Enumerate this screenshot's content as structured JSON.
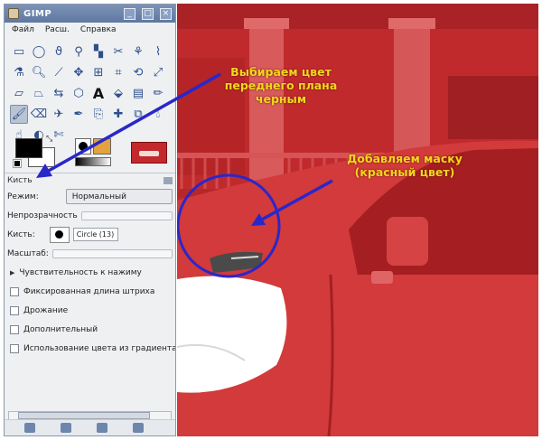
{
  "window": {
    "title": "GIMP"
  },
  "menu": [
    "Файл",
    "Расш.",
    "Справка"
  ],
  "tools": [
    {
      "icon": "rect-select-icon",
      "glyph": "▭"
    },
    {
      "icon": "ellipse-select-icon",
      "glyph": "◯"
    },
    {
      "icon": "free-select-icon",
      "glyph": "ϑ"
    },
    {
      "icon": "fuzzy-select-icon",
      "glyph": "⚲"
    },
    {
      "icon": "select-by-color-icon",
      "glyph": "▚"
    },
    {
      "icon": "scissors-icon",
      "glyph": "✂"
    },
    {
      "icon": "foreground-select-icon",
      "glyph": "⚘"
    },
    {
      "icon": "paths-icon",
      "glyph": "⌇"
    },
    {
      "icon": "color-picker-icon",
      "glyph": "⚗"
    },
    {
      "icon": "zoom-icon",
      "glyph": "🔍︎"
    },
    {
      "icon": "measure-icon",
      "glyph": "⟋"
    },
    {
      "icon": "move-icon",
      "glyph": "✥"
    },
    {
      "icon": "alignment-icon",
      "glyph": "⊞"
    },
    {
      "icon": "crop-icon",
      "glyph": "⌗"
    },
    {
      "icon": "rotate-icon",
      "glyph": "⟲"
    },
    {
      "icon": "scale-icon",
      "glyph": "⤢"
    },
    {
      "icon": "shear-icon",
      "glyph": "▱"
    },
    {
      "icon": "perspective-icon",
      "glyph": "⏢"
    },
    {
      "icon": "flip-icon",
      "glyph": "⇆"
    },
    {
      "icon": "cage-icon",
      "glyph": "⬡"
    },
    {
      "icon": "text-icon",
      "glyph": "A"
    },
    {
      "icon": "bucket-fill-icon",
      "glyph": "⬙"
    },
    {
      "icon": "blend-icon",
      "glyph": "▤"
    },
    {
      "icon": "pencil-icon",
      "glyph": "✏"
    },
    {
      "icon": "paintbrush-icon",
      "glyph": "🖌︎"
    },
    {
      "icon": "eraser-icon",
      "glyph": "⌫"
    },
    {
      "icon": "airbrush-icon",
      "glyph": "✈"
    },
    {
      "icon": "ink-icon",
      "glyph": "✒"
    },
    {
      "icon": "clone-icon",
      "glyph": "⎘"
    },
    {
      "icon": "heal-icon",
      "glyph": "✚"
    },
    {
      "icon": "perspective-clone-icon",
      "glyph": "⧉"
    },
    {
      "icon": "convolve-icon",
      "glyph": "💧︎"
    },
    {
      "icon": "smudge-icon",
      "glyph": "☝"
    },
    {
      "icon": "dodge-burn-icon",
      "glyph": "◐"
    },
    {
      "icon": "scissors-alt-icon",
      "glyph": "✄"
    }
  ],
  "tool_options": {
    "header": "Кисть",
    "mode_label": "Режим:",
    "mode_value": "Нормальный",
    "opacity_label": "Непрозрачность",
    "opacity_level": 1.0,
    "brush_label": "Кисть:",
    "brush_name": "Circle (13)",
    "scale_label": "Масштаб:",
    "scale_level": 1.0,
    "pressure_label": "Чувствительность к нажиму",
    "checkboxes": [
      "Фиксированная длина штриха",
      "Дрожание",
      "Дополнительный",
      "Использование цвета из градиента"
    ]
  },
  "annotations": {
    "foreground": [
      "Выбираем цвет",
      "переднего плана",
      "черным"
    ],
    "mask": [
      "Добавляем маску",
      "(красный цвет)"
    ]
  },
  "colors": {
    "foreground": "#000000",
    "background": "#ffffff",
    "mask_tint": "#cc2a2c",
    "arrow": "#2a27c9",
    "annotation_text": "#f2d71b"
  }
}
